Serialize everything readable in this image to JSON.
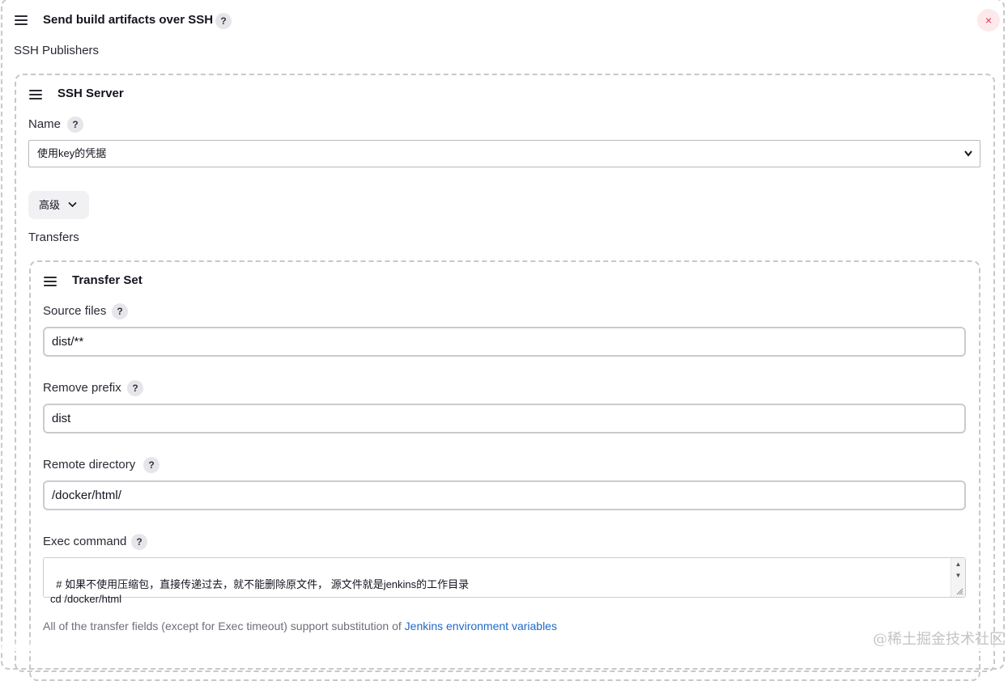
{
  "publisher": {
    "title": "Send build artifacts over SSH",
    "help": "?",
    "close_icon": "×",
    "section_label": "SSH Publishers"
  },
  "ssh_server": {
    "title": "SSH Server",
    "name_label": "Name",
    "name_help": "?",
    "name_value": "使用key的凭据",
    "advanced_label": "高级",
    "transfers_label": "Transfers"
  },
  "transfer_set": {
    "title": "Transfer Set",
    "source_files_label": "Source files",
    "source_files_help": "?",
    "source_files_value": "dist/**",
    "remove_prefix_label": "Remove prefix",
    "remove_prefix_help": "?",
    "remove_prefix_value": "dist",
    "remote_directory_label": "Remote directory",
    "remote_directory_help": "?",
    "remote_directory_value": "/docker/html/",
    "exec_command_label": "Exec command",
    "exec_command_help": "?",
    "exec_command_value": "# 如果不使用压缩包，直接传递过去，就不能删除原文件， 源文件就是jenkins的工作目录\ncd /docker/html",
    "note_text": "All of the transfer fields (except for Exec timeout) support substitution of ",
    "note_link": "Jenkins environment variables"
  },
  "watermark": "@稀土掘金技术社区",
  "icons": {
    "drag_handle": "drag-handle-icon",
    "close": "close-icon",
    "chevron": "chevron-down-icon"
  },
  "colors": {
    "link": "#1f69c8",
    "close_bg": "#fde8ea",
    "close_fg": "#e0334a"
  }
}
